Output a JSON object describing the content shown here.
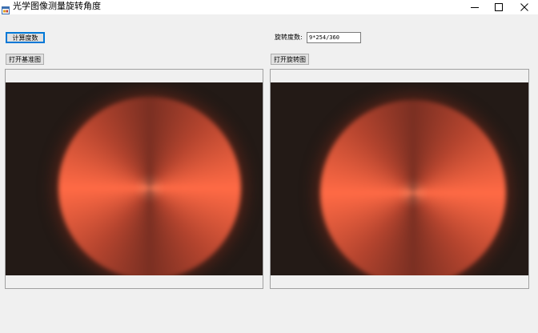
{
  "window": {
    "title": "光学图像测量旋转角度",
    "icon": "app-form-icon",
    "controls": [
      "minimize-icon",
      "maximize-icon",
      "close-icon"
    ]
  },
  "toolbar": {
    "calc_label": "计算度数",
    "open_base_label": "打开基准图",
    "open_rotated_label": "打开旋转图"
  },
  "result": {
    "label": "旋转度数:",
    "value": "9*254/360"
  },
  "images": {
    "base": {
      "content": "red-polarization-disc"
    },
    "rotated": {
      "content": "red-polarization-disc"
    }
  },
  "colors": {
    "accent_focus": "#0078d7",
    "window_bg": "#f0f0f0",
    "photo_bg": "#231a16",
    "disc_bright": "#ff6a45"
  }
}
